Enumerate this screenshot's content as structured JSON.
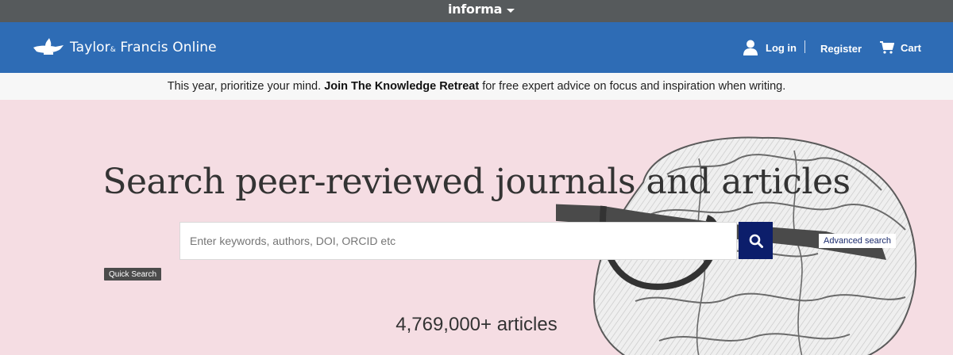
{
  "informa": {
    "label": "informa"
  },
  "header": {
    "brand_primary": "Taylor",
    "brand_amp": "&",
    "brand_secondary": "Francis Online",
    "login_label": "Log in",
    "register_label": "Register",
    "cart_label": "Cart"
  },
  "announcement": {
    "before": "This year, prioritize your mind. ",
    "link": "Join The Knowledge Retreat",
    "after": " for free expert advice on focus and inspiration when writing."
  },
  "hero": {
    "title": "Search peer-reviewed journals and articles",
    "search_placeholder": "Enter keywords, authors, DOI, ORCID etc",
    "search_value": "",
    "advanced_search_label": "Advanced search",
    "tooltip": "Quick Search",
    "article_count": "4,769,000+ articles"
  },
  "colors": {
    "informa_bar": "#565a5c",
    "header_blue": "#2e6cb5",
    "hero_pink": "#f5dde3",
    "search_button": "#0c1e6b"
  },
  "icons": {
    "brand": "lamp-logo-icon",
    "user": "user-icon",
    "cart": "cart-icon",
    "search": "search-icon",
    "caret": "caret-down-icon",
    "illustration": "brain-glasses-illustration"
  }
}
